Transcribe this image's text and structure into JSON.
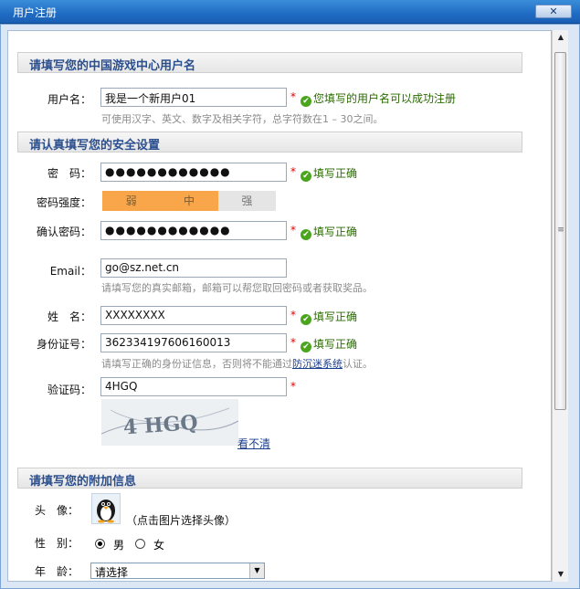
{
  "window": {
    "title": "用户注册",
    "close_label": "✕"
  },
  "sections": {
    "username": "请填写您的中国游戏中心用户名",
    "security": "请认真填写您的安全设置",
    "extra": "请填写您的附加信息"
  },
  "username": {
    "label": "用户名：",
    "value": "我是一个新用户01",
    "required": "*",
    "status": "您填写的用户名可以成功注册",
    "hint": "可使用汉字、英文、数字及相关字符，总字符数在1 – 30之间。"
  },
  "password": {
    "label": "密　码：",
    "value": "●●●●●●●●●●●●",
    "required": "*",
    "status": "填写正确"
  },
  "strength": {
    "label": "密码强度：",
    "levels": [
      "弱",
      "中",
      "强"
    ],
    "active_count": 2,
    "active_color": "#f9a64b"
  },
  "confirm": {
    "label": "确认密码：",
    "value": "●●●●●●●●●●●●",
    "required": "*",
    "status": "填写正确"
  },
  "email": {
    "label": "Email：",
    "value": "go@sz.net.cn",
    "hint": "请填写您的真实邮箱，邮箱可以帮您取回密码或者获取奖品。"
  },
  "name": {
    "label": "姓　名：",
    "value": "XXXXXXXX",
    "required": "*",
    "status": "填写正确"
  },
  "idcard": {
    "label": "身份证号：",
    "value": "362334197606160013",
    "required": "*",
    "status": "填写正确",
    "hint_prefix": "请填写正确的身份证信息，否则将不能通过",
    "hint_link": "防沉迷系统",
    "hint_suffix": "认证。"
  },
  "captcha": {
    "label": "验证码：",
    "value": "4HGQ",
    "required": "*",
    "image_text": "4 HGQ",
    "refresh_label": "看不清"
  },
  "avatar": {
    "label": "头　像：",
    "hint": "（点击图片选择头像）"
  },
  "gender": {
    "label": "性　别：",
    "options": [
      "男",
      "女"
    ],
    "selected": "男"
  },
  "age": {
    "label": "年　龄：",
    "selected": "请选择"
  },
  "colors": {
    "accent": "#2b4f8e",
    "titlebar": "#1f6cc4",
    "ok": "#2a6b00",
    "required": "#e00000"
  }
}
